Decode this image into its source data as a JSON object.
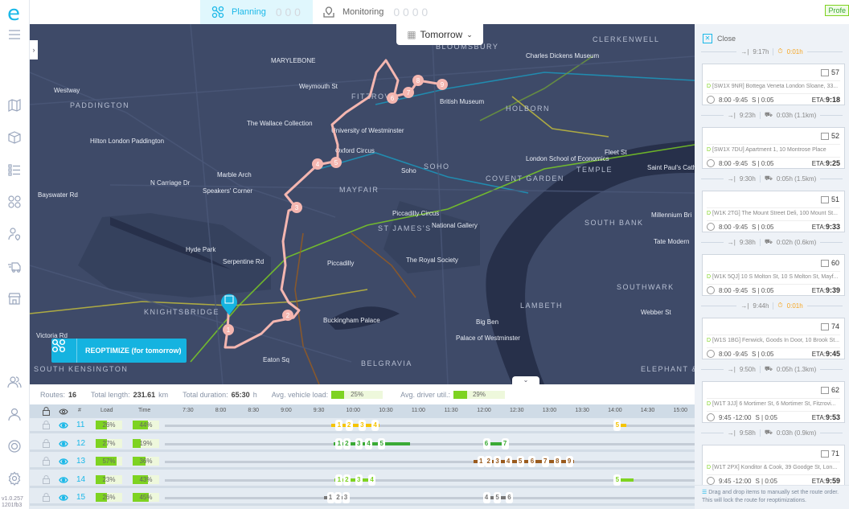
{
  "app": {
    "logo": "e",
    "version": "v1.0.257",
    "build": "1201fb3",
    "plan_badge": "Profe"
  },
  "sidebar": {
    "items": [
      {
        "icon": "hamburger-menu-icon"
      },
      {
        "icon": "map-icon"
      },
      {
        "icon": "package-icon"
      },
      {
        "icon": "list-icon"
      },
      {
        "icon": "routes-icon"
      },
      {
        "icon": "driver-location-icon"
      },
      {
        "icon": "delivery-truck-icon"
      },
      {
        "icon": "store-icon"
      },
      {
        "icon": "users-icon"
      },
      {
        "icon": "user-icon"
      },
      {
        "icon": "support-icon"
      },
      {
        "icon": "settings-icon"
      }
    ]
  },
  "tabs": [
    {
      "label": "Planning",
      "counts": "0 0 0",
      "active": true
    },
    {
      "label": "Monitoring",
      "counts": "0 0 0 0",
      "active": false
    }
  ],
  "map": {
    "date": "Tomorrow",
    "reoptimize_label": "REOPTIMIZE (for tomorrow)",
    "route_color": "#f4b6b0",
    "labels": [
      "MARYLEBONE",
      "BLOOMSBURY",
      "CLERKENWELL",
      "Charles Dickens Museum",
      "FITZROVIA",
      "British Museum",
      "HOLBORN",
      "PADDINGTON",
      "The Wallace Collection",
      "University of Westminster",
      "Hilton London Paddington",
      "Oxford Circus",
      "Marble Arch",
      "Soho",
      "SOHO",
      "London School of Economics",
      "TEMPLE",
      "Saint Paul's Cath",
      "Speakers' Corner",
      "MAYFAIR",
      "COVENT GARDEN",
      "Fleet St",
      "Piccadilly Circus",
      "ST JAMES'S",
      "National Gallery",
      "Millennium Bri",
      "SOUTH BANK",
      "Hyde Park",
      "The Royal Society",
      "Tate Modern",
      "Serpentine Rd",
      "SOUTHWARK",
      "KNIGHTSBRIDGE",
      "Buckingham Palace",
      "LAMBETH",
      "Big Ben",
      "Webber St",
      "Palace of Westminster",
      "BELGRAVIA",
      "SOUTH KENSINGTON",
      "ELEPHANT & CASTLE",
      "Bayswater Rd",
      "Westway",
      "Piccadilly",
      "Victoria Rd",
      "Eaton Sq",
      "N Carriage Dr",
      "Weymouth St"
    ],
    "stops": [
      "1",
      "2",
      "3",
      "4",
      "5",
      "6",
      "7",
      "8",
      "9"
    ]
  },
  "summary": {
    "routes_label": "Routes:",
    "routes": "16",
    "length_label": "Total length:",
    "length": "231.61",
    "length_unit": "km",
    "duration_label": "Total duration:",
    "duration": "65:30",
    "duration_unit": "h",
    "vehicle_load_label": "Avg. vehicle load:",
    "vehicle_load": "25%",
    "vehicle_load_value": 25,
    "driver_util_label": "Avg. driver util.:",
    "driver_util": "29%",
    "driver_util_value": 29
  },
  "timeline": {
    "headers": {
      "num": "#",
      "load": "Load",
      "time": "Time"
    },
    "ticks": [
      "7:30",
      "8:00",
      "8:30",
      "9:00",
      "9:30",
      "10:00",
      "10:30",
      "11:00",
      "11:30",
      "12:00",
      "12:30",
      "13:00",
      "13:30",
      "14:00",
      "14:30",
      "15:00"
    ],
    "rows": [
      {
        "id": "11",
        "load": "26%",
        "load_value": 26,
        "time": "44%",
        "time_value": 44,
        "color": "#f5c400",
        "clusters": [
          [
            "9:47",
            "9:56",
            "10:08",
            "10:20"
          ],
          [
            "14:02"
          ]
        ],
        "ends": [
          [
            "9:40",
            "10:24"
          ],
          [
            "14:02",
            "14:10"
          ]
        ]
      },
      {
        "id": "12",
        "load": "27%",
        "load_value": 27,
        "time": "19%",
        "time_value": 19,
        "color": "#3aaa35",
        "clusters": [
          [
            "9:47",
            "9:54",
            "10:05",
            "10:14",
            "10:26"
          ],
          [
            "12:02",
            "12:19"
          ]
        ],
        "ends": [
          [
            "9:42",
            "10:52"
          ],
          [
            "12:02",
            "12:20"
          ]
        ]
      },
      {
        "id": "13",
        "load": "57%",
        "load_value": 57,
        "time": "36%",
        "time_value": 36,
        "color": "#9a5b1e",
        "clusters": [
          [
            "11:57",
            "12:04",
            "12:12",
            "12:22",
            "12:33",
            "12:44",
            "12:56",
            "13:07",
            "13:18"
          ]
        ],
        "ends": [
          [
            "11:50",
            "13:22"
          ]
        ]
      },
      {
        "id": "14",
        "load": "23%",
        "load_value": 23,
        "time": "43%",
        "time_value": 43,
        "color": "#7ed321",
        "clusters": [
          [
            "9:47",
            "9:54",
            "10:05",
            "10:17"
          ],
          [
            "14:02"
          ]
        ],
        "ends": [
          [
            "9:43",
            "10:19"
          ],
          [
            "14:02",
            "14:17"
          ]
        ]
      },
      {
        "id": "15",
        "load": "26%",
        "load_value": 26,
        "time": "45%",
        "time_value": 45,
        "color": "#777777",
        "clusters": [
          [
            "9:39",
            "9:46",
            "9:53"
          ],
          [
            "12:02",
            "12:12",
            "12:23"
          ]
        ],
        "ends": [
          [
            "9:33",
            "9:55"
          ],
          [
            "12:00",
            "12:23"
          ]
        ]
      }
    ]
  },
  "panel": {
    "close_label": "Close",
    "connectors": [
      {
        "arrive": "9:17h",
        "kind": "wait",
        "info": "0:01h"
      },
      {
        "arrive": "9:23h",
        "kind": "drive",
        "info": "0:03h (1.1km)"
      },
      {
        "arrive": "9:30h",
        "kind": "drive",
        "info": "0:05h (1.5km)"
      },
      {
        "arrive": "9:38h",
        "kind": "drive",
        "info": "0:02h (0.6km)"
      },
      {
        "arrive": "9:44h",
        "kind": "wait",
        "info": "0:01h"
      },
      {
        "arrive": "9:50h",
        "kind": "drive",
        "info": "0:05h (1.3km)"
      },
      {
        "arrive": "9:58h",
        "kind": "drive",
        "info": "0:03h (0.9km)"
      }
    ],
    "cards": [
      {
        "num": "57",
        "type": "D",
        "address": "[SW1X 9NR] Bottega Veneta London Sloane, 33...",
        "window": "8:00 -9:45",
        "service": "S | 0:05",
        "eta_label": "ETA:",
        "eta": "9:18"
      },
      {
        "num": "52",
        "type": "D",
        "address": "[SW1X 7DU] Apartment 1, 10 Montrose Place",
        "window": "8:00 -9:45",
        "service": "S | 0:05",
        "eta_label": "ETA:",
        "eta": "9:25"
      },
      {
        "num": "51",
        "type": "D",
        "address": "[W1K 2TG] The Mount Street Deli, 100 Mount St...",
        "window": "8:00 -9:45",
        "service": "S | 0:05",
        "eta_label": "ETA:",
        "eta": "9:33"
      },
      {
        "num": "60",
        "type": "D",
        "address": "[W1K 5QJ] 10 S Molton St, 10 S Molton St, Mayf...",
        "window": "8:00 -9:45",
        "service": "S | 0:05",
        "eta_label": "ETA:",
        "eta": "9:39"
      },
      {
        "num": "74",
        "type": "D",
        "address": "[W1S 1BG] Fenwick, Goods In Door, 10 Brook St...",
        "window": "8:00 -9:45",
        "service": "S | 0:05",
        "eta_label": "ETA:",
        "eta": "9:45"
      },
      {
        "num": "62",
        "type": "D",
        "address": "[W1T 3JJ] 6 Mortimer St, 6 Mortimer St, Fitzrovi...",
        "window": "9:45 -12:00",
        "service": "S | 0:05",
        "eta_label": "ETA:",
        "eta": "9:53"
      },
      {
        "num": "71",
        "type": "D",
        "address": "[W1T 2PX] Konditor & Cook, 39 Goodge St, Lon...",
        "window": "9:45 -12:00",
        "service": "S | 0:05",
        "eta_label": "ETA:",
        "eta": "9:59"
      }
    ],
    "hint": "Drag and drop items to manually set the route order. This will lock the route for reoptimizations."
  }
}
